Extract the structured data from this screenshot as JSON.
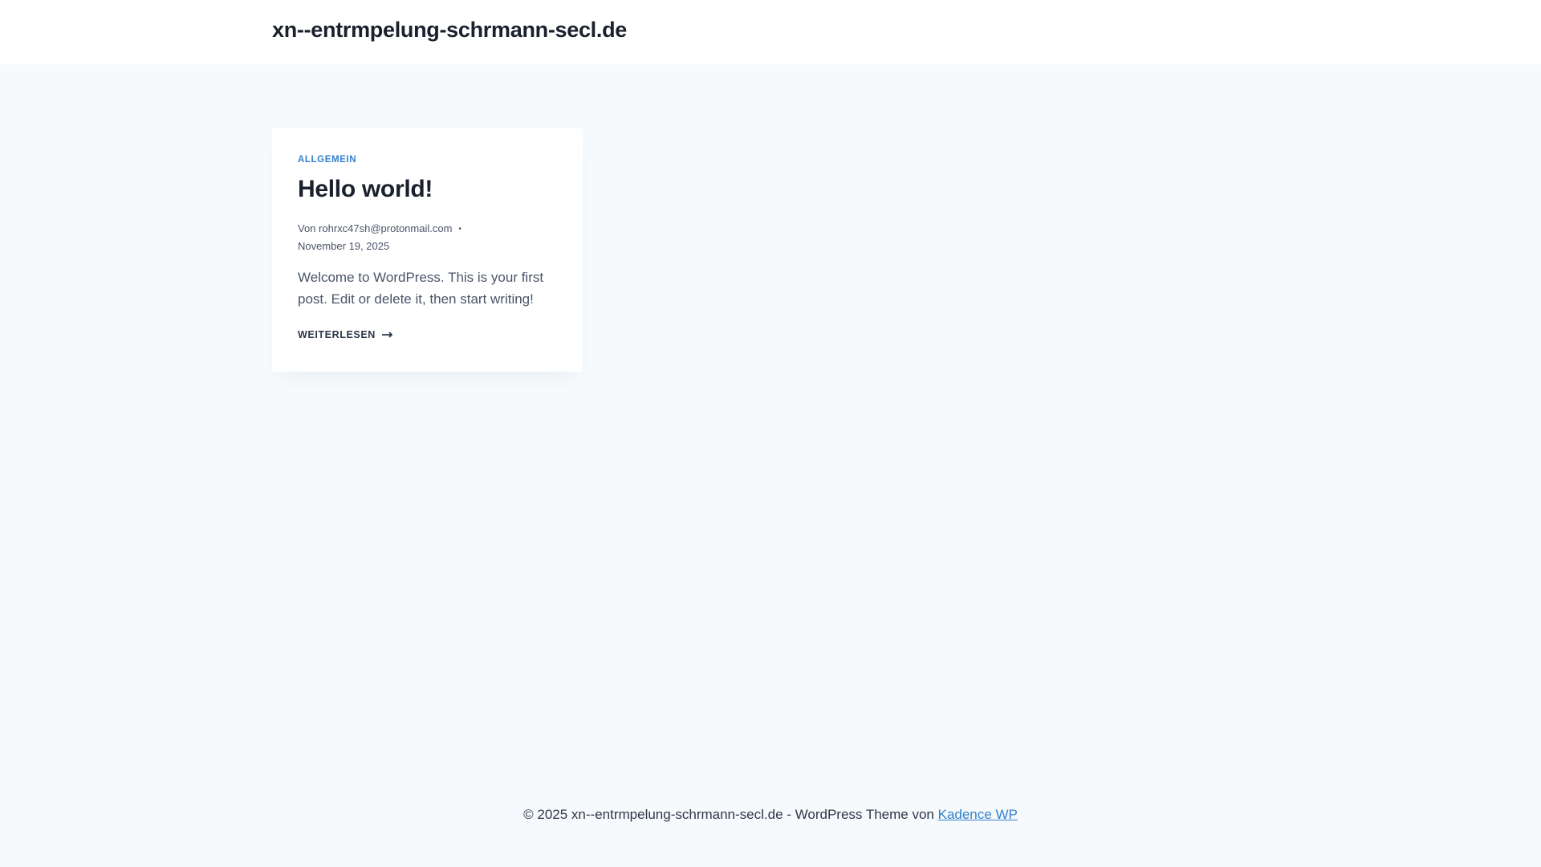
{
  "header": {
    "site_title": "xn--entrmpelung-schrmann-secl.de"
  },
  "post": {
    "category": "ALLGEMEIN",
    "title": "Hello world!",
    "author_prefix": "Von",
    "author": "rohrxc47sh@protonmail.com",
    "separator": "•",
    "date": "November 19, 2025",
    "excerpt": "Welcome to WordPress. This is your first post. Edit or delete it, then start writing!",
    "read_more": "WEITERLESEN"
  },
  "footer": {
    "text": "© 2025 xn--entrmpelung-schrmann-secl.de - WordPress Theme von",
    "link": "Kadence WP"
  },
  "colors": {
    "accent": "#3182ce",
    "background": "#f7fafc",
    "heading": "#1a202c"
  }
}
